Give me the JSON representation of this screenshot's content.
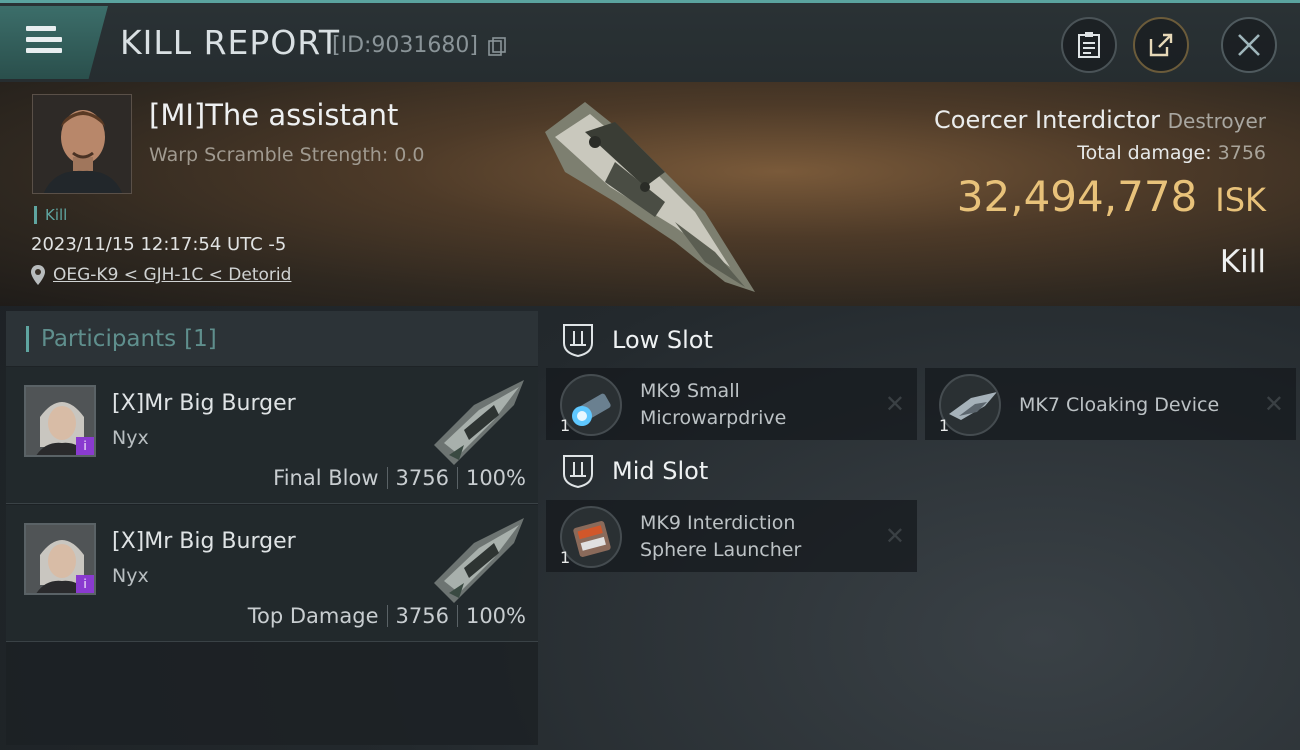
{
  "header": {
    "title": "KILL REPORT",
    "report_id": "[ID:9031680]"
  },
  "victim": {
    "name": "[MI]The assistant",
    "warp_scramble": "Warp Scramble Strength: 0.0",
    "tag": "Kill",
    "datetime": "2023/11/15 12:17:54 UTC -5",
    "location": "OEG-K9 < GJH-1C < Detorid",
    "ship_name": "Coercer Interdictor",
    "ship_class": "Destroyer",
    "total_damage_label": "Total damage:",
    "total_damage": "3756",
    "isk_value": "32,494,778",
    "isk_unit": "ISK",
    "result": "Kill"
  },
  "participants": {
    "header_label": "Participants",
    "header_count": "[1]",
    "rows": [
      {
        "name": "[X]Mr Big Burger",
        "ship": "Nyx",
        "role": "Final Blow",
        "damage": "3756",
        "percent": "100%"
      },
      {
        "name": "[X]Mr Big Burger",
        "ship": "Nyx",
        "role": "Top Damage",
        "damage": "3756",
        "percent": "100%"
      }
    ]
  },
  "slots": {
    "low": {
      "label": "Low Slot",
      "modules": [
        {
          "line1": "MK9 Small",
          "line2": "Microwarpdrive",
          "qty": "1"
        },
        {
          "line1": "MK7 Cloaking Device",
          "line2": "",
          "qty": "1"
        }
      ]
    },
    "mid": {
      "label": "Mid Slot",
      "modules": [
        {
          "line1": "MK9 Interdiction",
          "line2": "Sphere Launcher",
          "qty": "1"
        }
      ]
    }
  },
  "colors": {
    "accent": "#5fa5a0",
    "isk": "#e8c27a"
  },
  "icons": [
    "menu-icon",
    "copy-icon",
    "clipboard-icon",
    "share-icon",
    "close-icon",
    "location-pin-icon",
    "shield-icon",
    "remove-icon"
  ]
}
